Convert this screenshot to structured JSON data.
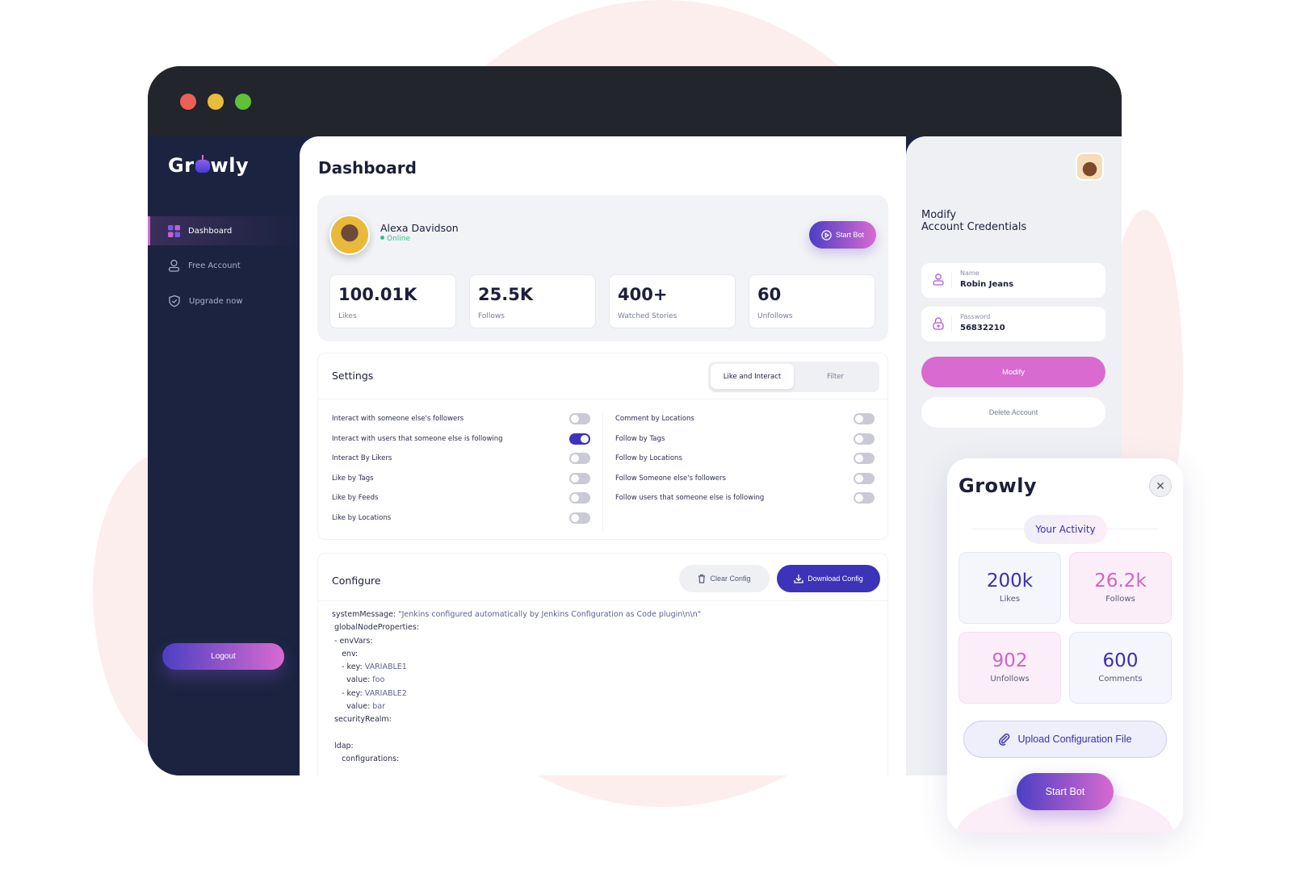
{
  "brand": {
    "name": "Growly",
    "prefix": "Gr",
    "suffix": "wly"
  },
  "colors": {
    "accent": "#3c33b8",
    "pink": "#d86ad0",
    "sidebar": "#1c2340",
    "online": "#2bc48a"
  },
  "window": {
    "buttons": [
      "close",
      "minimize",
      "maximize"
    ]
  },
  "sidebar": {
    "items": [
      {
        "label": "Dashboard",
        "icon": "grid-icon",
        "active": true
      },
      {
        "label": "Free Account",
        "icon": "user-icon"
      },
      {
        "label": "Upgrade now",
        "icon": "shield-check-icon"
      }
    ],
    "logout": "Logout"
  },
  "main": {
    "title": "Dashboard",
    "profile": {
      "name": "Alexa Davidson",
      "status": "Online",
      "start_bot": "Start Bot"
    },
    "stats": [
      {
        "value": "100.01K",
        "label": "Likes"
      },
      {
        "value": "25.5K",
        "label": "Follows"
      },
      {
        "value": "400+",
        "label": "Watched Stories"
      },
      {
        "value": "60",
        "label": "Unfollows"
      }
    ],
    "settings": {
      "title": "Settings",
      "tabs": [
        "Like and Interact",
        "Filter"
      ],
      "active_tab": "Like and Interact",
      "left": [
        {
          "label": "Interact with someone else's followers",
          "on": false
        },
        {
          "label": "Interact with users that someone else is following",
          "on": true
        },
        {
          "label": "Interact By Likers",
          "on": false
        },
        {
          "label": "Like by Tags",
          "on": false
        },
        {
          "label": "Like by Feeds",
          "on": false
        },
        {
          "label": "Like by Locations",
          "on": false
        }
      ],
      "right": [
        {
          "label": "Comment by Locations",
          "on": false
        },
        {
          "label": "Follow by Tags",
          "on": false
        },
        {
          "label": "Follow by Locations",
          "on": false
        },
        {
          "label": "Follow Someone else's followers",
          "on": false
        },
        {
          "label": "Follow users that someone else is following",
          "on": false
        }
      ]
    },
    "configure": {
      "title": "Configure",
      "clear": "Clear Config",
      "download": "Download Config",
      "lines": [
        [
          "systemMessage: ",
          "\"Jenkins configured automatically by Jenkins Configuration as Code plugin\\n\\n\""
        ],
        [
          " globalNodeProperties:",
          ""
        ],
        [
          " - envVars:",
          ""
        ],
        [
          "    env:",
          ""
        ],
        [
          "    - key: ",
          "VARIABLE1"
        ],
        [
          "      value: ",
          "foo"
        ],
        [
          "    - key: ",
          "VARIABLE2"
        ],
        [
          "      value: ",
          "bar"
        ],
        [
          " securityRealm:",
          ""
        ],
        [
          "",
          ""
        ],
        [
          " ldap:",
          ""
        ],
        [
          "    configurations:",
          ""
        ]
      ]
    }
  },
  "credentials": {
    "title_line1": "Modify",
    "title_line2": "Account Credentials",
    "name_label": "Name",
    "name_value": "Robin Jeans",
    "password_label": "Password",
    "password_value": "56832210",
    "modify": "Modify",
    "delete": "Delete Account"
  },
  "activity": {
    "title": "Your Activity",
    "tiles": [
      {
        "value": "200k",
        "label": "Likes"
      },
      {
        "value": "26.2k",
        "label": "Follows"
      },
      {
        "value": "902",
        "label": "Unfollows"
      },
      {
        "value": "600",
        "label": "Comments"
      }
    ],
    "upload": "Upload Configuration File",
    "start_bot": "Start Bot"
  }
}
